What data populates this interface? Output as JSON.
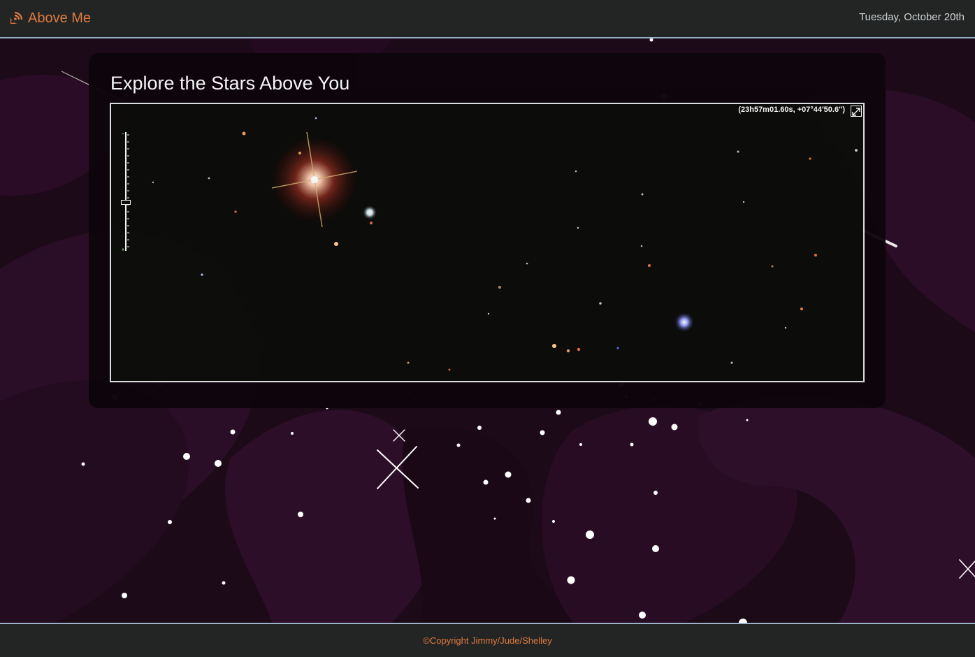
{
  "header": {
    "brand": "Above Me",
    "brand_icon": "satellite-dish-icon",
    "date": "Tuesday, October 20th"
  },
  "main": {
    "title": "Explore the Stars Above You",
    "sky_viewer": {
      "coordinates": "(23h57m01.60s, +07°44′50.6″)",
      "fullscreen_icon": "fullscreen-icon"
    }
  },
  "footer": {
    "copyright": "©Copyright Jimmy/Jude/Shelley"
  },
  "colors": {
    "accent": "#e07a3f",
    "bar": "#232525",
    "bar_border": "#9bb3c8",
    "background": "#1c0a19"
  }
}
